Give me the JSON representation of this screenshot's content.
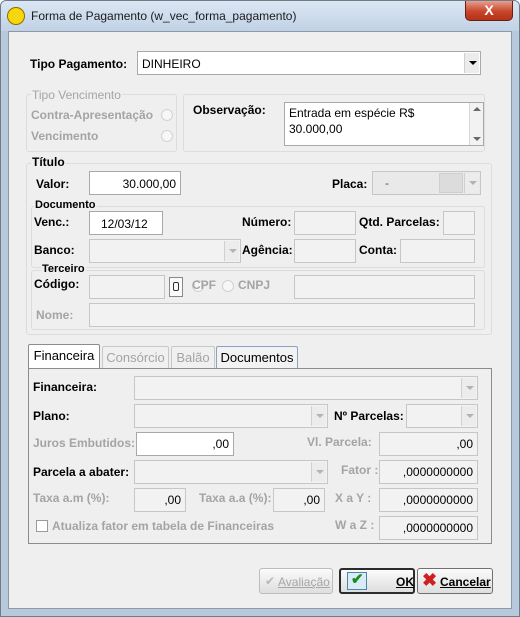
{
  "window": {
    "title": "Forma de Pagamento (w_vec_forma_pagamento)",
    "close_label": "X"
  },
  "tipo_pagamento": {
    "label": "Tipo Pagamento:",
    "value": "DINHEIRO"
  },
  "tipo_vencimento": {
    "group_label": "Tipo Vencimento",
    "opt1": "Contra-Apresentação",
    "opt2": "Vencimento"
  },
  "observacao": {
    "label": "Observação:",
    "line1": "Entrada em espécie R$",
    "line2": "30.000,00"
  },
  "titulo": {
    "group_label": "Título",
    "valor_label": "Valor:",
    "valor": "30.000,00",
    "placa_label": "Placa:",
    "placa_value": "-"
  },
  "documento": {
    "group_label": "Documento",
    "venc_label": "Venc.:",
    "venc_value": "12/03/12",
    "numero_label": "Número:",
    "qtd_parcelas_label": "Qtd. Parcelas:",
    "banco_label": "Banco:",
    "agencia_label": "Agência:",
    "conta_label": "Conta:"
  },
  "terceiro": {
    "group_label": "Terceiro",
    "codigo_label": "Código:",
    "cpf": "CPF",
    "cnpj": "CNPJ",
    "nome_label": "Nome:"
  },
  "tabs": [
    "Financeira",
    "Consórcio",
    "Balão",
    "Documentos"
  ],
  "financeira": {
    "financeira_label": "Financeira:",
    "plano_label": "Plano:",
    "n_parcelas_label": "Nº Parcelas:",
    "juros_label": "Juros Embutidos:",
    "juros_value": ",00",
    "vl_parcela_label": "Vl. Parcela:",
    "vl_parcela_value": ",00",
    "parcela_abater_label": "Parcela a abater:",
    "fator_label": "Fator :",
    "fator_value": ",0000000000",
    "taxa_am_label": "Taxa a.m (%):",
    "taxa_am_value": ",00",
    "taxa_aa_label": "Taxa a.a (%):",
    "taxa_aa_value": ",00",
    "xay_label": "X a Y :",
    "xay_value": ",0000000000",
    "waz_label": "W a Z :",
    "waz_value": ",0000000000",
    "atualiza_label": "Atualiza fator em tabela de Financeiras"
  },
  "buttons": {
    "avaliacao": "Avaliação",
    "ok": "OK",
    "cancelar": "Cancelar"
  },
  "colors": {
    "title_bar": "#c9d8ea",
    "close": "#c8452b",
    "window_bg": "#efefef"
  }
}
